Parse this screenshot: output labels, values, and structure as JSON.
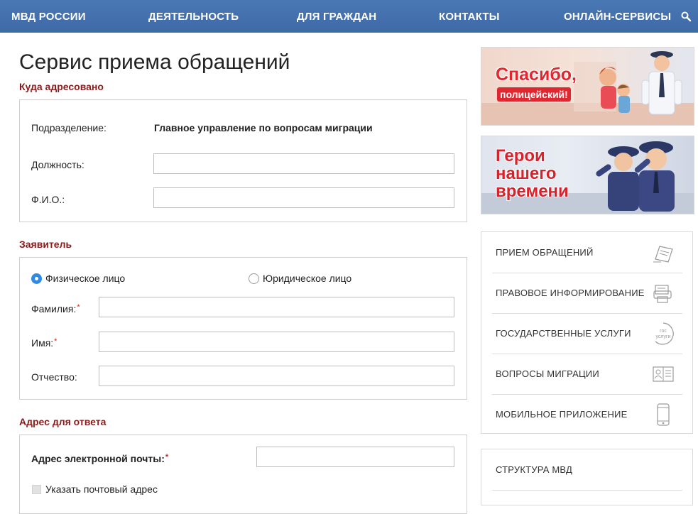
{
  "nav": {
    "items": [
      "МВД РОССИИ",
      "ДЕЯТЕЛЬНОСТЬ",
      "ДЛЯ ГРАЖДАН",
      "КОНТАКТЫ",
      "ОНЛАЙН-СЕРВИСЫ"
    ],
    "background": "#4574b0"
  },
  "page": {
    "title": "Сервис приема обращений"
  },
  "addressee": {
    "section_title": "Куда адресовано",
    "division_label": "Подразделение:",
    "division_value": "Главное управление по вопросам миграции",
    "position_label": "Должность:",
    "position_value": "",
    "fio_label": "Ф.И.О.:",
    "fio_value": ""
  },
  "applicant": {
    "section_title": "Заявитель",
    "type_options": [
      "Физическое лицо",
      "Юридическое лицо"
    ],
    "selected_type": "Физическое лицо",
    "surname_label": "Фамилия:",
    "name_label": "Имя:",
    "patronymic_label": "Отчество:",
    "required_mark": "*",
    "surname_value": "",
    "name_value": "",
    "patronymic_value": ""
  },
  "reply_address": {
    "section_title": "Адрес для ответа",
    "email_label": "Адрес электронной почты:",
    "email_value": "",
    "postal_checkbox_label": "Указать почтовый адрес",
    "postal_checked": false
  },
  "banners": {
    "thanks": {
      "line1": "Спасибо,",
      "line2": "полицейский!"
    },
    "heroes": {
      "line1": "Герои",
      "line2": "нашего",
      "line3": "времени"
    }
  },
  "side_menu": {
    "items": [
      {
        "label": "ПРИЕМ ОБРАЩЕНИЙ",
        "icon": "document-pen-icon"
      },
      {
        "label": "ПРАВОВОЕ ИНФОРМИРОВАНИЕ",
        "icon": "printer-icon"
      },
      {
        "label": "ГОСУДАРСТВЕННЫЕ УСЛУГИ",
        "icon": "gosuslugi-icon",
        "icon_text": "гос услуги"
      },
      {
        "label": "ВОПРОСЫ МИГРАЦИИ",
        "icon": "passport-icon"
      },
      {
        "label": "МОБИЛЬНОЕ ПРИЛОЖЕНИЕ",
        "icon": "smartphone-icon"
      }
    ]
  },
  "structure_panel": {
    "label": "СТРУКТУРА МВД"
  },
  "colors": {
    "accent_red": "#8b1a1a",
    "radio_blue": "#2f8ae6",
    "required_red": "#c0262c"
  }
}
